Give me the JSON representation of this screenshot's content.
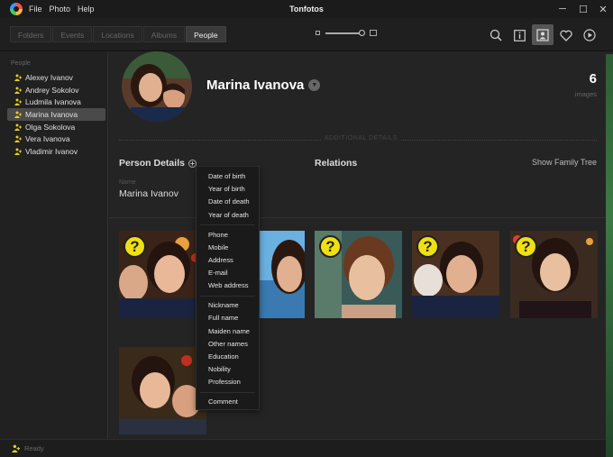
{
  "window": {
    "title": "Tonfotos",
    "menu": [
      "File",
      "Photo",
      "Help"
    ],
    "controls": {
      "minimize": "─",
      "maximize": "☐",
      "close": "✕"
    }
  },
  "toolbar": {
    "tabs": [
      {
        "label": "Folders",
        "active": false
      },
      {
        "label": "Events",
        "active": false
      },
      {
        "label": "Locations",
        "active": false
      },
      {
        "label": "Albums",
        "active": false
      },
      {
        "label": "People",
        "active": true
      }
    ],
    "tools": [
      "search-icon",
      "info-icon",
      "person-card-icon",
      "heart-icon",
      "play-icon"
    ],
    "accent": "#555555"
  },
  "sidebar": {
    "heading": "People",
    "people": [
      {
        "name": "Alexey Ivanov",
        "selected": false
      },
      {
        "name": "Andrey Sokolov",
        "selected": false
      },
      {
        "name": "Ludmila Ivanova",
        "selected": false
      },
      {
        "name": "Marina Ivanova",
        "selected": true
      },
      {
        "name": "Olga Sokolova",
        "selected": false
      },
      {
        "name": "Vera Ivanova",
        "selected": false
      },
      {
        "name": "Vladimir Ivanov",
        "selected": false
      }
    ],
    "person_icon_color": "#e8d020"
  },
  "profile": {
    "name": "Marina Ivanova",
    "image_count": "6",
    "image_count_label": "images",
    "divider_label": "ADDITIONAL DETAILS",
    "person_details_label": "Person Details",
    "relations_label": "Relations",
    "family_tree_link": "Show Family Tree",
    "field_label": "Name",
    "field_value": "Marina Ivanov"
  },
  "dropdown": {
    "groups": [
      [
        "Date of birth",
        "Year of birth",
        "Date of death",
        "Year of death"
      ],
      [
        "Phone",
        "Mobile",
        "Address",
        "E-mail",
        "Web address"
      ],
      [
        "Nickname",
        "Full name",
        "Maiden name",
        "Other names",
        "Education",
        "Nobility",
        "Profession"
      ],
      [
        "Comment"
      ]
    ]
  },
  "photos": {
    "unknown_face_marker": "?",
    "marker_color": "#f0e010"
  },
  "status": {
    "text": "Ready"
  }
}
